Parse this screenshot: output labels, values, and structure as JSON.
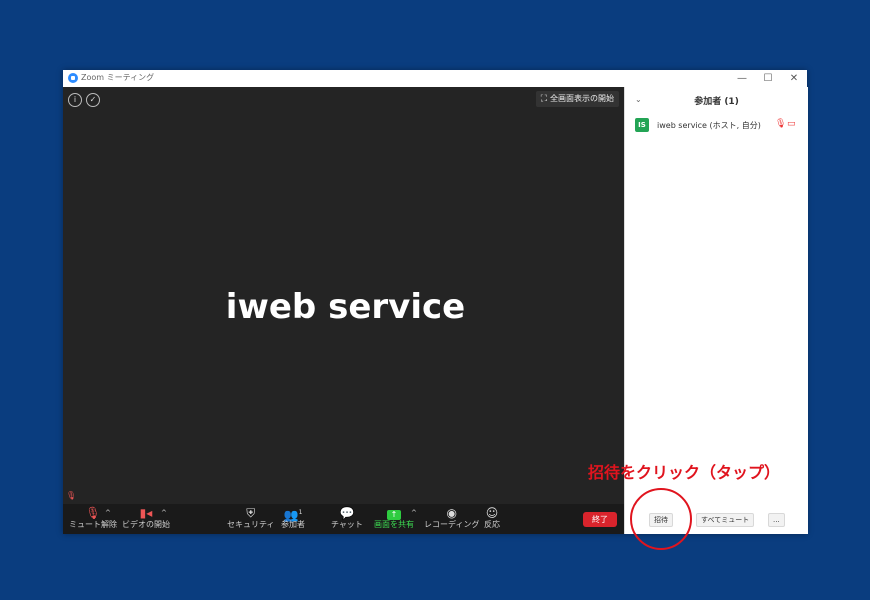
{
  "window": {
    "title": "Zoom ミーティング",
    "controls": {
      "minimize": "—",
      "maximize": "☐",
      "close": "✕"
    }
  },
  "video": {
    "info_icon": "i",
    "shield_icon": "✓",
    "fullscreen_label": "全画面表示の開始",
    "participant_name": "iweb service"
  },
  "toolbar": {
    "unmute_label": "ミュート解除",
    "video_label": "ビデオの開始",
    "security_label": "セキュリティ",
    "participants_label": "参加者",
    "participants_count": "1",
    "chat_label": "チャット",
    "share_label": "画面を共有",
    "record_label": "レコーディング",
    "reactions_label": "反応",
    "end_label": "終了"
  },
  "panel": {
    "title": "参加者 (1)",
    "participants": [
      {
        "initials": "IS",
        "name": "iweb service (ホスト, 自分)"
      }
    ],
    "invite_label": "招待",
    "mute_all_label": "すべてミュート",
    "more_label": "..."
  },
  "annotation": {
    "text": "招待をクリック（タップ）",
    "color": "#e0141e"
  },
  "colors": {
    "background": "#0a3d7f",
    "video_bg": "#242424",
    "toolbar_bg": "#1a1a1a",
    "accent_green": "#3ddc52",
    "end_red": "#d9242c",
    "avatar_green": "#23a455"
  }
}
